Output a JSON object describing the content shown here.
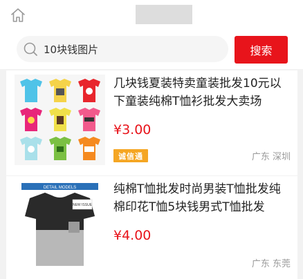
{
  "header": {
    "home_icon": "home-icon"
  },
  "search": {
    "query": "10块钱图片",
    "button_label": "搜索"
  },
  "products": [
    {
      "title": "几块钱夏装特卖童装批发10元以下童装纯棉T恤衫批发大卖场",
      "price": "¥3.00",
      "badge": "诚信通",
      "location": "广东  深圳"
    },
    {
      "title": "纯棉T恤批发时尚男装T恤批发纯棉印花T恤5块钱男式T恤批发",
      "price": "¥4.00",
      "location": "广东  东莞",
      "image_caption": "DETAIL MODELS",
      "image_subcaption": "NEW ISSUE"
    }
  ],
  "colors": {
    "accent": "#e8141b",
    "badge": "#f5a623"
  }
}
